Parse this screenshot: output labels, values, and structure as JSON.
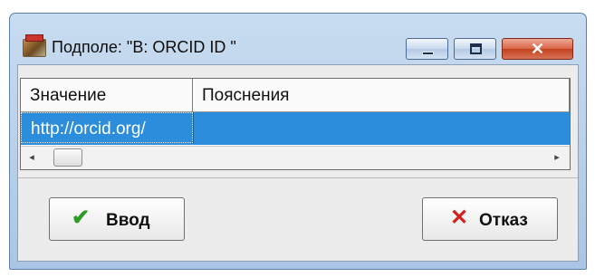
{
  "window": {
    "title": "Подполе: \"B: ORCID ID \"",
    "app_icon": "app-icon",
    "controls": {
      "minimize_icon": "minimize-icon",
      "maximize_icon": "maximize-icon",
      "close_icon": "close-icon",
      "close_glyph": "✕"
    }
  },
  "grid": {
    "columns": [
      "Значение",
      "Пояснения"
    ],
    "rows": [
      {
        "value": "http://orcid.org/",
        "note": ""
      }
    ],
    "selected_row": 0,
    "scroll_left_glyph": "◂",
    "scroll_right_glyph": "▸"
  },
  "buttons": {
    "ok_label": "Ввод",
    "ok_glyph": "✔",
    "cancel_label": "Отказ",
    "cancel_glyph": "✕"
  },
  "colors": {
    "selection": "#2b8ddb",
    "ok_icon": "#2f9a24",
    "cancel_icon": "#d0231b",
    "close_button": "#d86547"
  }
}
